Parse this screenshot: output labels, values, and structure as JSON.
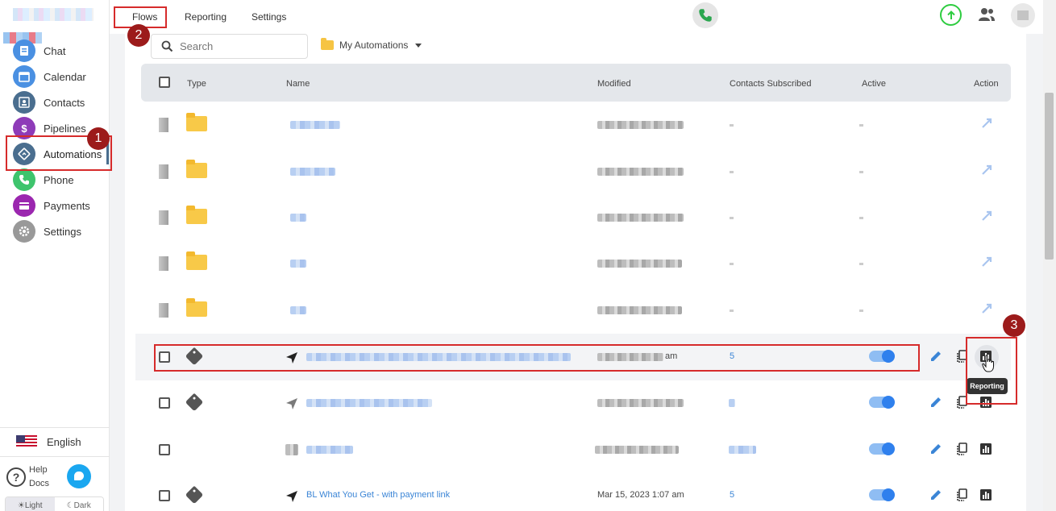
{
  "sidebar": {
    "items": [
      {
        "label": "Chat",
        "icon": "chat-icon",
        "color": "#4a90e2"
      },
      {
        "label": "Calendar",
        "icon": "calendar-icon",
        "color": "#4a90e2"
      },
      {
        "label": "Contacts",
        "icon": "contacts-icon",
        "color": "#4a6e8f"
      },
      {
        "label": "Pipelines",
        "icon": "dollar-icon",
        "color": "#8e3bb8"
      },
      {
        "label": "Automations",
        "icon": "automations-icon",
        "color": "#4a6e8f"
      },
      {
        "label": "Phone",
        "icon": "phone-icon",
        "color": "#3ec46d"
      },
      {
        "label": "Payments",
        "icon": "payments-icon",
        "color": "#9b27af"
      },
      {
        "label": "Settings",
        "icon": "gear-icon",
        "color": "#999999"
      }
    ],
    "language": "English",
    "help_label": "Help Docs",
    "theme_light": "☀Light",
    "theme_dark": "☾Dark"
  },
  "topbar": {
    "tabs": [
      "Flows",
      "Reporting",
      "Settings"
    ]
  },
  "toolbar": {
    "search_placeholder": "Search",
    "folder_label": "My Automations"
  },
  "table": {
    "headers": {
      "type": "Type",
      "name": "Name",
      "modified": "Modified",
      "contacts": "Contacts Subscribed",
      "active": "Active",
      "action": "Action"
    },
    "visible_row": {
      "name": "BL What You Get - with payment link",
      "modified": "Mar 15, 2023 1:07 am",
      "contacts": "5"
    },
    "highlight_row": {
      "modified_partial": "am",
      "contacts": "5"
    }
  },
  "tooltip": "Reporting",
  "annotations": [
    "1",
    "2",
    "3"
  ],
  "colors": {
    "accent_blue": "#2f80ed",
    "annotation_red": "#d62b2b",
    "marker_red": "#9c1b1b",
    "upload_green": "#2ecc40",
    "folder_yellow": "#f8c948"
  }
}
